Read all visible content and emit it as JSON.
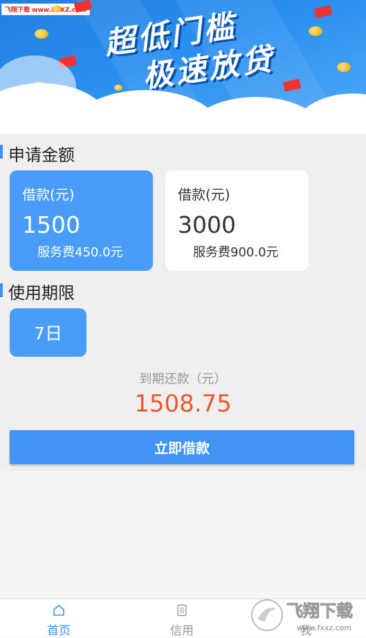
{
  "banner": {
    "watermark": "飞翔下载 www.FXXZ.com",
    "line1": "超低门槛",
    "line2": "极速放贷",
    "envelope_label": "红包"
  },
  "loan_amount": {
    "title": "申请金额",
    "cards": [
      {
        "label": "借款(元)",
        "amount": "1500",
        "fee": "服务费450.0元",
        "selected": true
      },
      {
        "label": "借款(元)",
        "amount": "3000",
        "fee": "服务费900.0元",
        "selected": false
      }
    ]
  },
  "term": {
    "title": "使用期限",
    "option": "7日"
  },
  "due": {
    "label": "到期还款（元）",
    "value": "1508.75"
  },
  "submit_label": "立即借款",
  "tabs": [
    {
      "label": "首页",
      "icon": "home-icon",
      "active": true
    },
    {
      "label": "信用",
      "icon": "document-icon",
      "active": false
    },
    {
      "label": "我",
      "icon": "user-icon",
      "active": false
    }
  ],
  "watermark_corner": "飞翔下载 www.fxxz.com",
  "colors": {
    "accent": "#4a9cf9",
    "due_amount": "#f0562b",
    "active_tab": "#3f8ef5",
    "inactive_tab": "#999999"
  }
}
